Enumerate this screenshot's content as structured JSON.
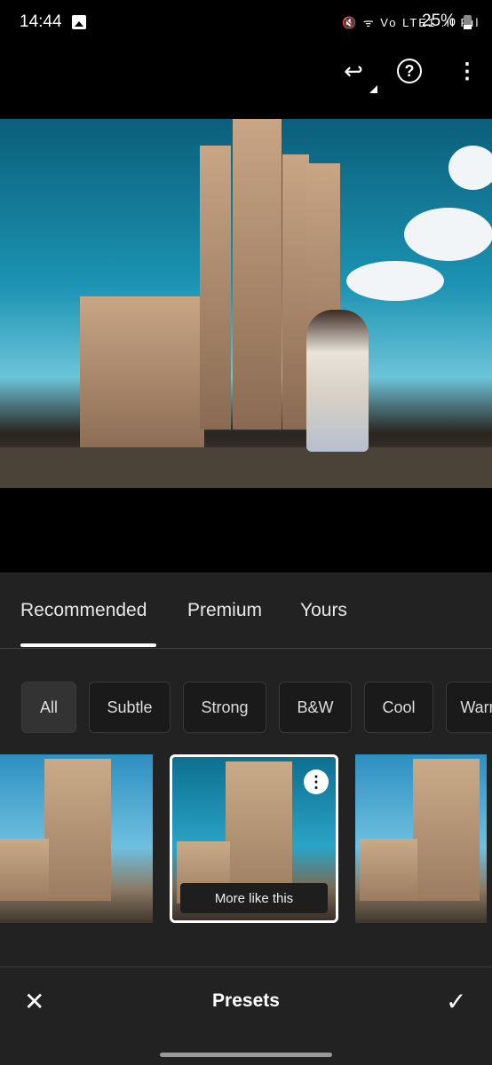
{
  "status_bar": {
    "time": "14:44",
    "icons": "🔇 ᯤ Vo LTE1 .ıl Rıl",
    "battery": "25%"
  },
  "toolbar": {
    "undo_icon": "undo-icon",
    "help_icon": "help-icon",
    "more_icon": "more-vertical-icon"
  },
  "tabs": [
    {
      "label": "Recommended",
      "selected": true
    },
    {
      "label": "Premium"
    },
    {
      "label": "Yours"
    }
  ],
  "chips": [
    {
      "label": "All",
      "selected": true
    },
    {
      "label": "Subtle"
    },
    {
      "label": "Strong"
    },
    {
      "label": "B&W"
    },
    {
      "label": "Cool"
    },
    {
      "label": "Warm"
    }
  ],
  "thumbnails": {
    "selected_index": 1,
    "more_like_this": "More like this"
  },
  "bottom_bar": {
    "title": "Presets",
    "close": "✕",
    "confirm": "✓"
  },
  "colors": {
    "panel": "#222222",
    "accent": "#ffffff"
  }
}
